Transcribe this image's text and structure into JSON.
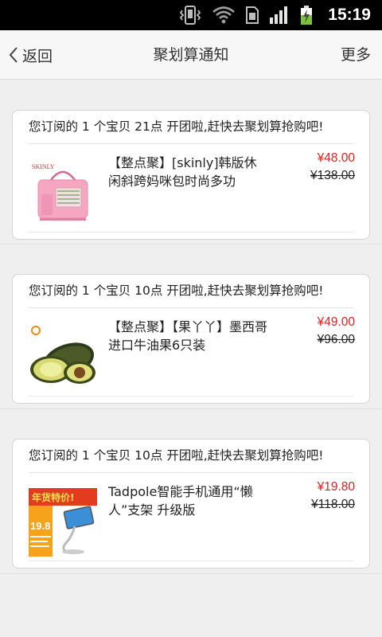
{
  "status_bar": {
    "time": "15:19",
    "icons": [
      "vibrate-icon",
      "wifi-icon",
      "sim-icon",
      "signal-icon",
      "battery-charging-icon"
    ]
  },
  "header": {
    "back_label": "返回",
    "title": "聚划算通知",
    "more_label": "更多"
  },
  "notifications": [
    {
      "message": "您订阅的 1 个宝贝 21点 开团啦,赶快去聚划算抢购吧!",
      "item": {
        "name": "【整点聚】[skinly]韩版休闲斜跨妈咪包时尚多功",
        "price": "¥48.00",
        "original_price": "¥138.00",
        "thumb_brand": "SKINLY"
      }
    },
    {
      "message": "您订阅的 1 个宝贝 10点 开团啦,赶快去聚划算抢购吧!",
      "item": {
        "name": "【整点聚】【果丫丫】墨西哥进口牛油果6只装",
        "price": "¥49.00",
        "original_price": "¥96.00"
      }
    },
    {
      "message": "您订阅的 1 个宝贝 10点 开团啦,赶快去聚划算抢购吧!",
      "item": {
        "name": "Tadpole智能手机通用“懒人”支架 升级版",
        "price": "¥19.80",
        "original_price": "¥118.00",
        "thumb_banner": "年货特价!",
        "thumb_price": "19.8"
      }
    }
  ],
  "colors": {
    "price_red": "#e4201c",
    "nav_bg": "#f7f7f7",
    "page_bg": "#efefef"
  }
}
